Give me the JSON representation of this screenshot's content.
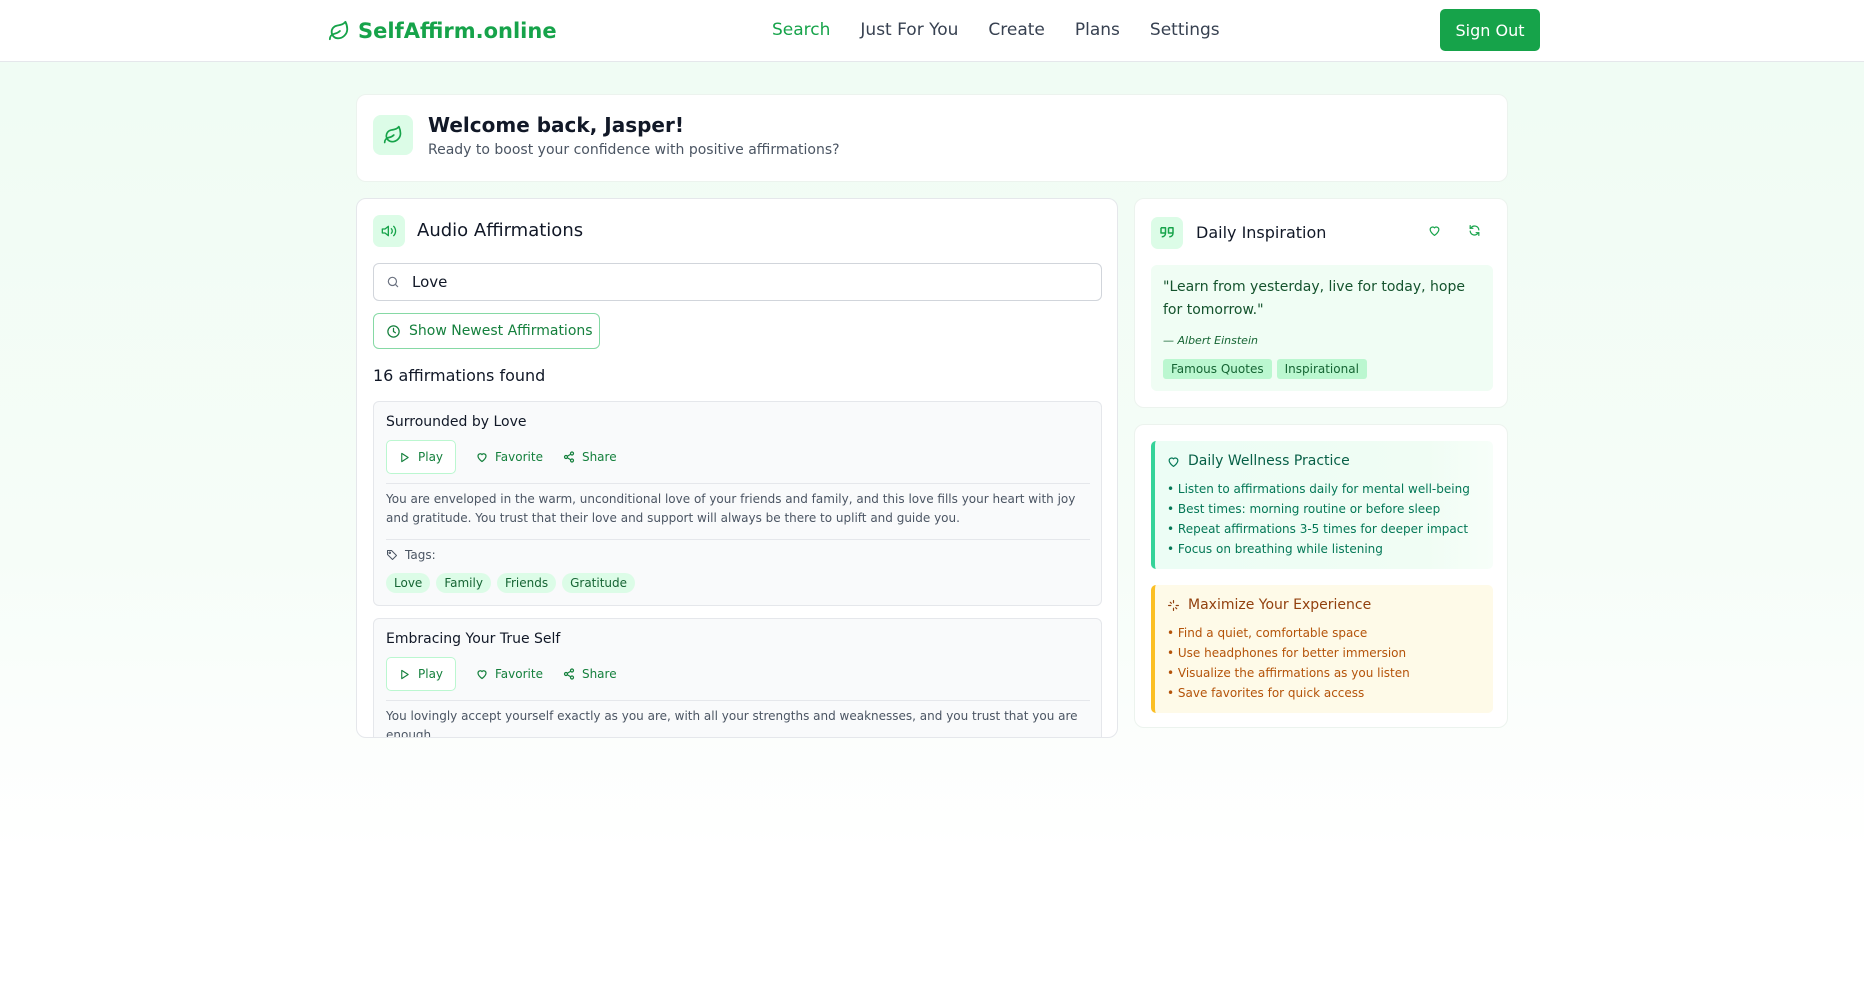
{
  "header": {
    "brand": "SelfAffirm.online",
    "nav": [
      "Search",
      "Just For You",
      "Create",
      "Plans",
      "Settings"
    ],
    "active_nav": "Search",
    "sign_out": "Sign Out"
  },
  "welcome": {
    "title": "Welcome back, Jasper!",
    "subtitle": "Ready to boost your confidence with positive affirmations?"
  },
  "audio": {
    "title": "Audio Affirmations",
    "search_value": "Love",
    "newest_button": "Show Newest Affirmations",
    "count_text": "16 affirmations found",
    "play_label": "Play",
    "favorite_label": "Favorite",
    "share_label": "Share",
    "tags_label": "Tags:",
    "items": [
      {
        "title": "Surrounded by Love",
        "description": "You are enveloped in the warm, unconditional love of your friends and family, and this love fills your heart with joy and gratitude. You trust that their love and support will always be there to uplift and guide you.",
        "tags": [
          "Love",
          "Family",
          "Friends",
          "Gratitude"
        ]
      },
      {
        "title": "Embracing Your True Self",
        "description": "You lovingly accept yourself exactly as you are, with all your strengths and weaknesses, and you trust that you are enough."
      }
    ]
  },
  "inspiration": {
    "title": "Daily Inspiration",
    "quote": "\"Learn from yesterday, live for today, hope for tomorrow.\"",
    "author": "— Albert Einstein",
    "tags": [
      "Famous Quotes",
      "Inspirational"
    ]
  },
  "tips": {
    "wellness": {
      "title": "Daily Wellness Practice",
      "items": [
        "• Listen to affirmations daily for mental well-being",
        "• Best times: morning routine or before sleep",
        "• Repeat affirmations 3-5 times for deeper impact",
        "• Focus on breathing while listening"
      ]
    },
    "maximize": {
      "title": "Maximize Your Experience",
      "items": [
        "• Find a quiet, comfortable space",
        "• Use headphones for better immersion",
        "• Visualize the affirmations as you listen",
        "• Save favorites for quick access"
      ]
    }
  },
  "colors": {
    "brand": "#16a34a",
    "accent_light": "#dcfce7",
    "warning_border": "#fbbf24",
    "success_border": "#34d399"
  },
  "icons": {
    "brand": "leaf-icon",
    "audio": "volume-icon",
    "search": "search-icon",
    "newest": "clock-icon",
    "play": "play-icon",
    "favorite": "heart-icon",
    "share": "share-icon",
    "tags": "tag-icon",
    "inspiration": "quote-icon",
    "refresh": "refresh-icon",
    "maximize": "sparkle-icon"
  }
}
